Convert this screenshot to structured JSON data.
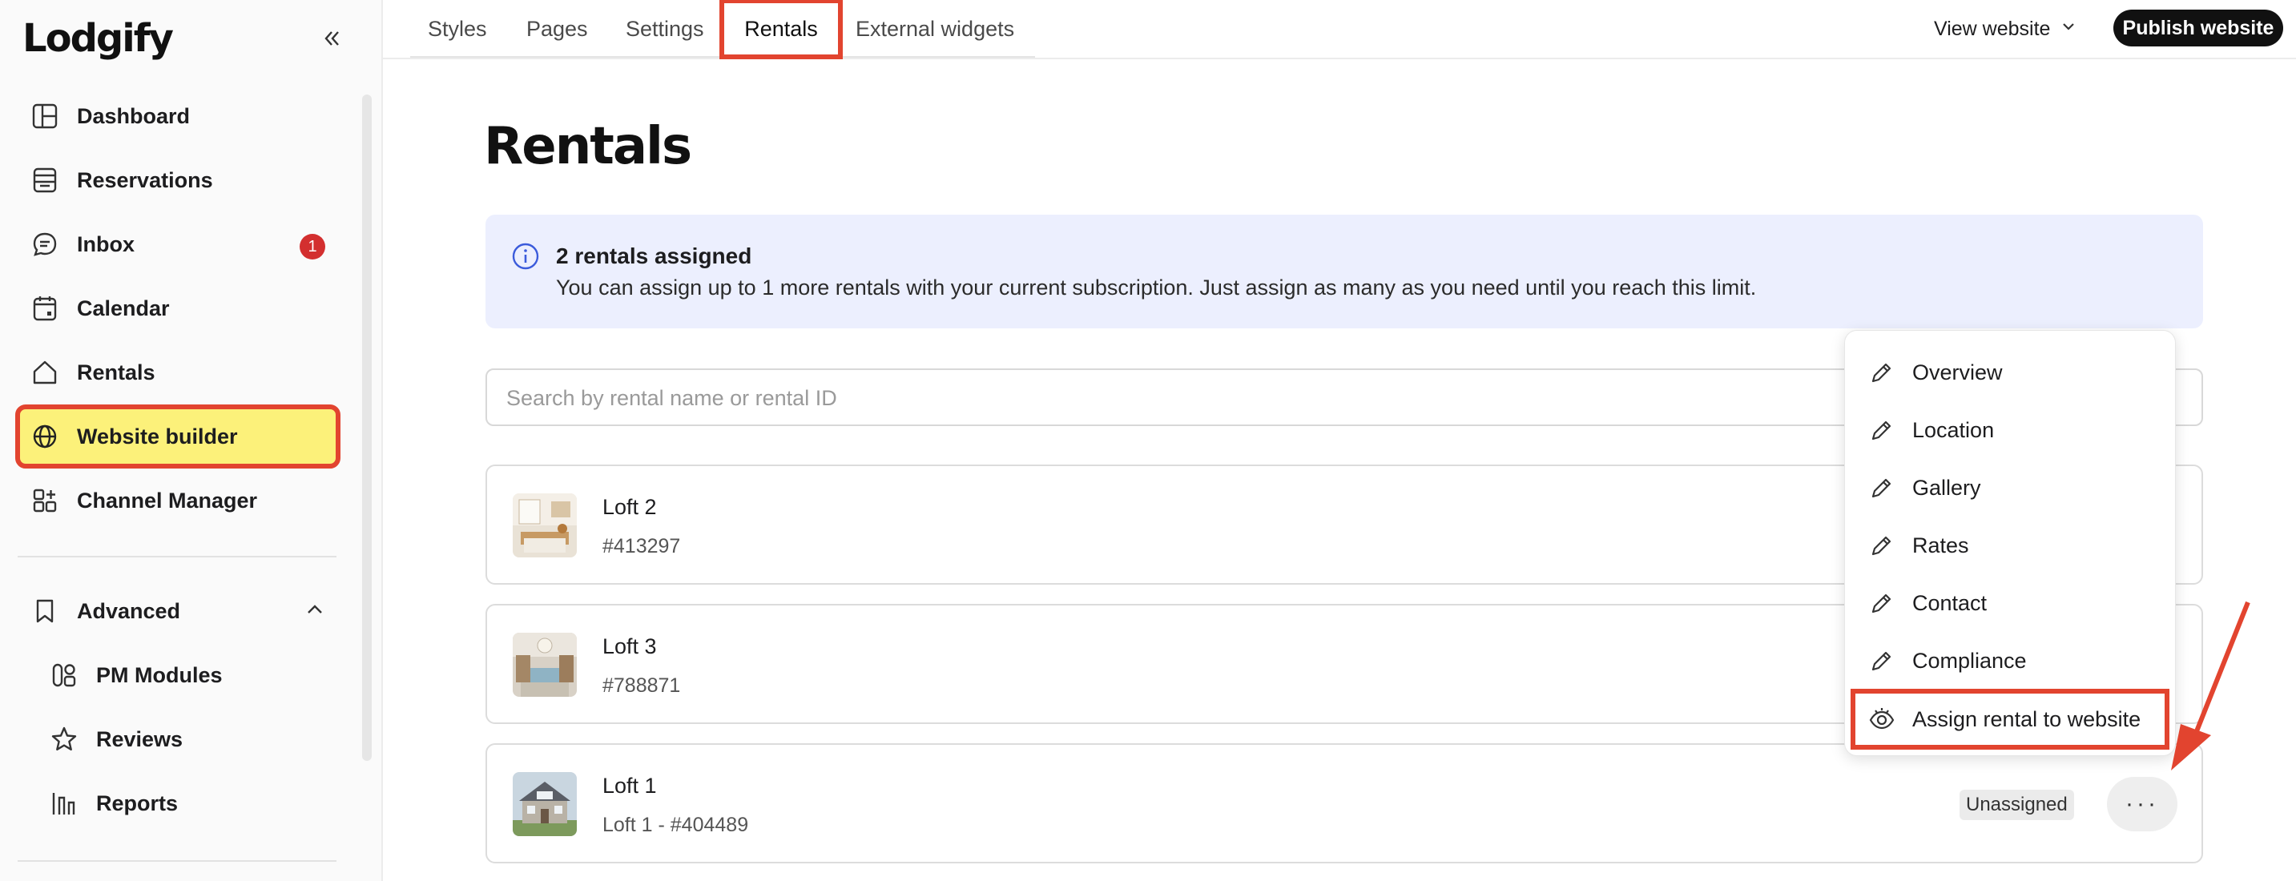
{
  "app": {
    "logo": "Lodgify"
  },
  "sidebar": {
    "items": [
      {
        "label": "Dashboard",
        "icon": "layout-icon"
      },
      {
        "label": "Reservations",
        "icon": "reservations-icon"
      },
      {
        "label": "Inbox",
        "icon": "chat-icon",
        "badge": "1"
      },
      {
        "label": "Calendar",
        "icon": "calendar-icon"
      },
      {
        "label": "Rentals",
        "icon": "home-icon"
      },
      {
        "label": "Website builder",
        "icon": "globe-icon"
      },
      {
        "label": "Channel Manager",
        "icon": "channels-icon"
      }
    ],
    "advanced": {
      "label": "Advanced",
      "items": [
        {
          "label": "PM Modules",
          "icon": "modules-icon"
        },
        {
          "label": "Reviews",
          "icon": "star-icon"
        },
        {
          "label": "Reports",
          "icon": "reports-icon"
        }
      ]
    }
  },
  "topbar": {
    "tabs": [
      "Styles",
      "Pages",
      "Settings",
      "Rentals",
      "External widgets"
    ],
    "active_tab": "Rentals",
    "view_website": "View website",
    "publish": "Publish website"
  },
  "main": {
    "title": "Rentals",
    "info": {
      "heading": "2 rentals assigned",
      "text": "You can assign up to 1 more rentals with your current subscription. Just assign as many as you need until you reach this limit."
    },
    "search_placeholder": "Search by rental name or rental ID",
    "rentals": [
      {
        "name": "Loft 2",
        "id": "#413297"
      },
      {
        "name": "Loft 3",
        "id": "#788871"
      },
      {
        "name": "Loft 1",
        "id": "Loft 1 - #404489",
        "status": "Unassigned"
      }
    ],
    "more_button": "···"
  },
  "context_menu": {
    "items": [
      {
        "label": "Overview",
        "icon": "pencil-icon"
      },
      {
        "label": "Location",
        "icon": "pencil-icon"
      },
      {
        "label": "Gallery",
        "icon": "pencil-icon"
      },
      {
        "label": "Rates",
        "icon": "pencil-icon"
      },
      {
        "label": "Contact",
        "icon": "pencil-icon"
      },
      {
        "label": "Compliance",
        "icon": "pencil-icon"
      },
      {
        "label": "Assign rental to website",
        "icon": "eye-icon"
      }
    ]
  },
  "colors": {
    "highlight": "#e2442f",
    "active_bg": "#fcf17a",
    "badge": "#d32f2f",
    "info_bg": "#eceffe"
  }
}
